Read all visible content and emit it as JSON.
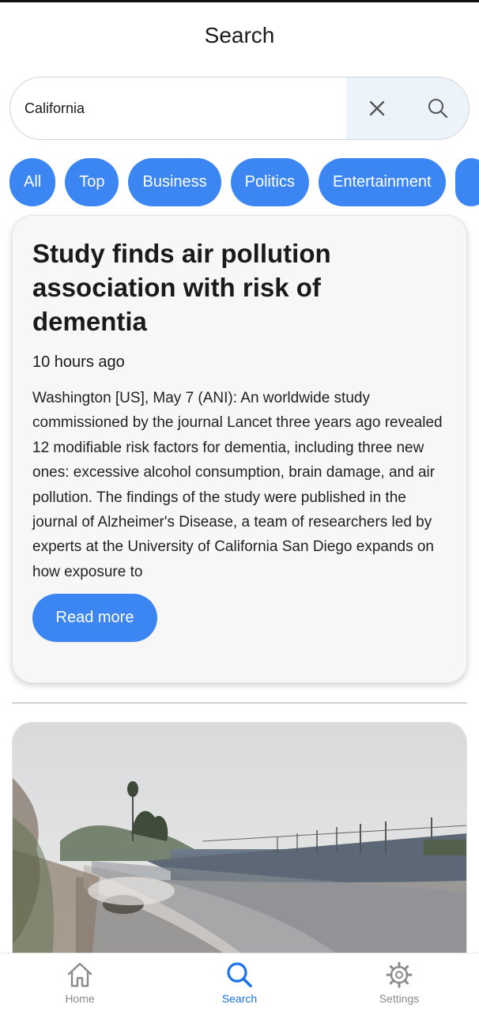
{
  "header": {
    "title": "Search"
  },
  "search": {
    "value": "California"
  },
  "categories": [
    "All",
    "Top",
    "Business",
    "Politics",
    "Entertainment"
  ],
  "article": {
    "title": "Study finds air pollution association with risk of dementia",
    "time": "10 hours ago",
    "body": "Washington [US], May 7 (ANI): An worldwide study commissioned by the journal Lancet three years ago revealed 12 modifiable risk factors for dementia, including three new ones: excessive alcohol consumption, brain damage, and air pollution. The findings of the study were published in the journal of Alzheimer's Disease, a team of researchers led by experts at the University of California San Diego expands on how exposure to",
    "read_more_label": "Read more"
  },
  "nav": {
    "home_label": "Home",
    "search_label": "Search",
    "settings_label": "Settings",
    "active": "Search"
  },
  "colors": {
    "accent": "#3b86f3",
    "nav_active": "#1a73e8",
    "nav_inactive": "#8a8a8a"
  }
}
